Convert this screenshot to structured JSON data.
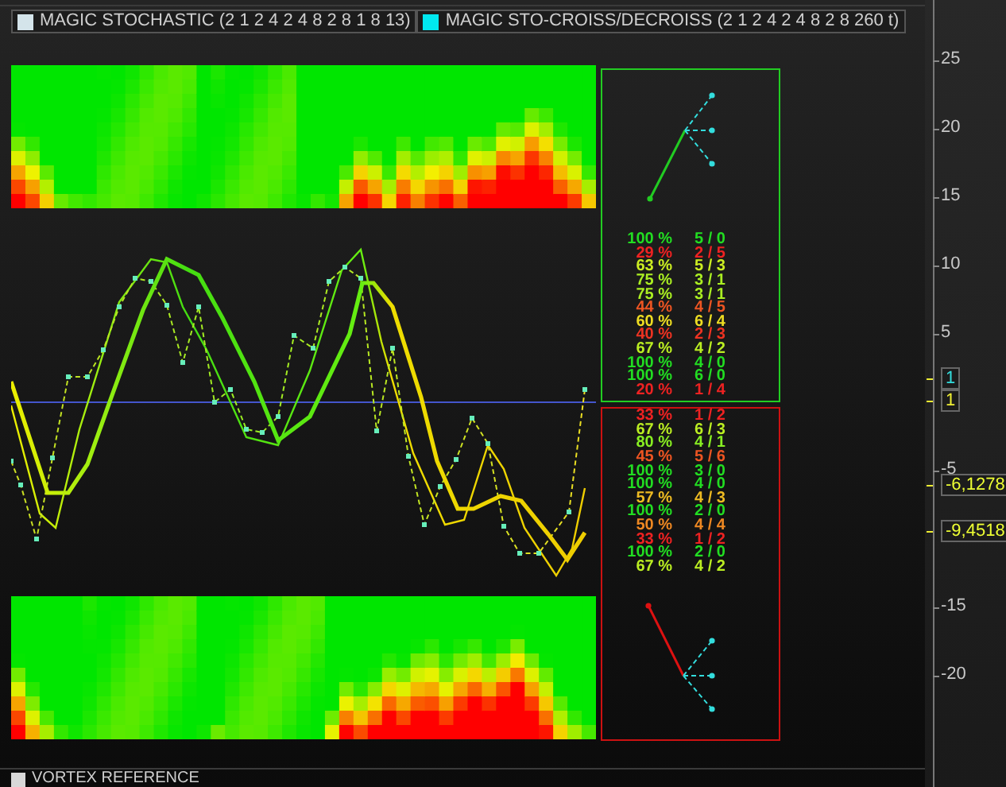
{
  "legend": [
    {
      "label": "MAGIC STOCHASTIC (2 1 2 4 2 4 8 2 8 1 8 13)",
      "color": "#d4e4ea"
    },
    {
      "label": "MAGIC STO-CROISS/DECROISS (2 1 2 4 2 4 8 2 8 260 t)",
      "color": "#00e8f0"
    }
  ],
  "up_panel": {
    "color": "#22cc22",
    "stats": [
      {
        "percent": "100 %",
        "ratio": "5 / 0",
        "color": "#22dd22"
      },
      {
        "percent": "29 %",
        "ratio": "2 / 5",
        "color": "#ee2222"
      },
      {
        "percent": "63 %",
        "ratio": "5 / 3",
        "color": "#ccee22"
      },
      {
        "percent": "75 %",
        "ratio": "3 / 1",
        "color": "#aaee22"
      },
      {
        "percent": "75 %",
        "ratio": "3 / 1",
        "color": "#aaee22"
      },
      {
        "percent": "44 %",
        "ratio": "4 / 5",
        "color": "#ee5522"
      },
      {
        "percent": "60 %",
        "ratio": "6 / 4",
        "color": "#eedd22"
      },
      {
        "percent": "40 %",
        "ratio": "2 / 3",
        "color": "#ee3322"
      },
      {
        "percent": "67 %",
        "ratio": "4 / 2",
        "color": "#bbee22"
      },
      {
        "percent": "100 %",
        "ratio": "4 / 0",
        "color": "#22dd22"
      },
      {
        "percent": "100 %",
        "ratio": "6 / 0",
        "color": "#22dd22"
      },
      {
        "percent": "20 %",
        "ratio": "1 / 4",
        "color": "#ee2222"
      }
    ]
  },
  "down_panel": {
    "color": "#cc1111",
    "stats": [
      {
        "percent": "33 %",
        "ratio": "1 / 2",
        "color": "#ee2222"
      },
      {
        "percent": "67 %",
        "ratio": "6 / 3",
        "color": "#bbee22"
      },
      {
        "percent": "80 %",
        "ratio": "4 / 1",
        "color": "#88ee22"
      },
      {
        "percent": "45 %",
        "ratio": "5 / 6",
        "color": "#ee5522"
      },
      {
        "percent": "100 %",
        "ratio": "3 / 0",
        "color": "#22dd22"
      },
      {
        "percent": "100 %",
        "ratio": "4 / 0",
        "color": "#22dd22"
      },
      {
        "percent": "57 %",
        "ratio": "4 / 3",
        "color": "#eebb22"
      },
      {
        "percent": "100 %",
        "ratio": "2 / 0",
        "color": "#22dd22"
      },
      {
        "percent": "50 %",
        "ratio": "4 / 4",
        "color": "#ee8822"
      },
      {
        "percent": "33 %",
        "ratio": "1 / 2",
        "color": "#ee2222"
      },
      {
        "percent": "100 %",
        "ratio": "2 / 0",
        "color": "#22dd22"
      },
      {
        "percent": "67 %",
        "ratio": "4 / 2",
        "color": "#bbee22"
      }
    ]
  },
  "axis": {
    "ticks": [
      "25",
      "20",
      "15",
      "10",
      "5",
      "-5",
      "-15",
      "-20"
    ],
    "badges": [
      {
        "text": "1",
        "color": "#33dddd"
      },
      {
        "text": "1",
        "color": "#eeee33"
      },
      {
        "text": "-6,1278",
        "color": "#eeff33"
      },
      {
        "text": "-9,4518",
        "color": "#eeff33"
      }
    ]
  },
  "footer_legend": {
    "label": "VORTEX REFERENCE",
    "color": "#d8d8d8"
  }
}
